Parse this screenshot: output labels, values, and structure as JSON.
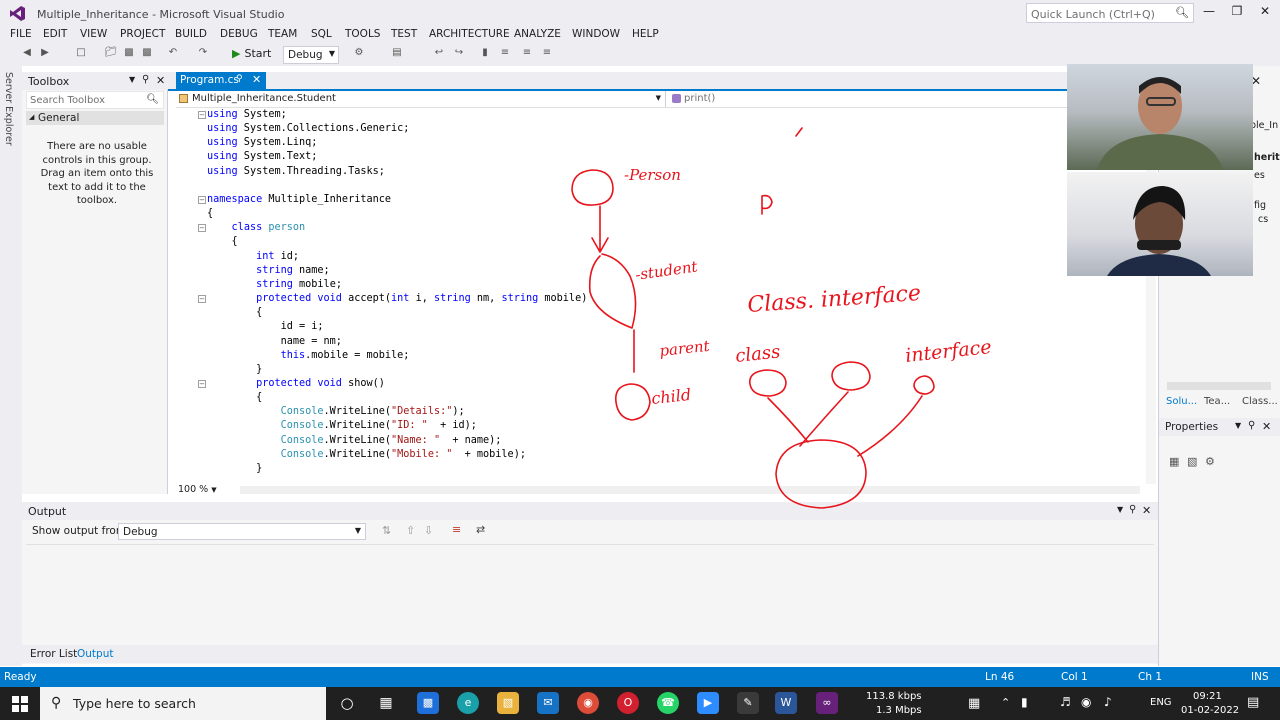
{
  "window": {
    "title": "Multiple_Inheritance - Microsoft Visual Studio",
    "quick_launch_placeholder": "Quick Launch (Ctrl+Q)"
  },
  "menu": [
    "FILE",
    "EDIT",
    "VIEW",
    "PROJECT",
    "BUILD",
    "DEBUG",
    "TEAM",
    "SQL",
    "TOOLS",
    "TEST",
    "ARCHITECTURE",
    "ANALYZE",
    "WINDOW",
    "HELP"
  ],
  "toolbar": {
    "start_label": "Start",
    "config": "Debug"
  },
  "toolbox": {
    "title": "Toolbox",
    "search_placeholder": "Search Toolbox",
    "group": "General",
    "empty_message": "There are no usable controls in this group. Drag an item onto this text to add it to the toolbox."
  },
  "server_explorer": "Server Explorer",
  "editor": {
    "tab": "Program.cs",
    "nav_type": "Multiple_Inheritance.Student",
    "nav_member": "print()",
    "zoom": "100 %",
    "lines": [
      [
        [
          "kw",
          "using"
        ],
        [
          "",
          "System;"
        ]
      ],
      [
        [
          "kw",
          "using"
        ],
        [
          "",
          "System.Collections.Generic;"
        ]
      ],
      [
        [
          "kw",
          "using"
        ],
        [
          "",
          "System.Linq;"
        ]
      ],
      [
        [
          "kw",
          "using"
        ],
        [
          "",
          "System.Text;"
        ]
      ],
      [
        [
          "kw",
          "using"
        ],
        [
          "",
          "System.Threading.Tasks;"
        ]
      ],
      [],
      [
        [
          "kw",
          "namespace"
        ],
        [
          "",
          "Multiple_Inheritance"
        ]
      ],
      [
        [
          "",
          "{"
        ]
      ],
      [
        [
          "",
          "    "
        ],
        [
          "kw",
          "class"
        ],
        [
          "ty",
          "person"
        ]
      ],
      [
        [
          "",
          "    {"
        ]
      ],
      [
        [
          "",
          "        "
        ],
        [
          "kw",
          "int"
        ],
        [
          "",
          "id;"
        ]
      ],
      [
        [
          "",
          "        "
        ],
        [
          "kw",
          "string"
        ],
        [
          "",
          "name;"
        ]
      ],
      [
        [
          "",
          "        "
        ],
        [
          "kw",
          "string"
        ],
        [
          "",
          "mobile;"
        ]
      ],
      [
        [
          "",
          "        "
        ],
        [
          "kw",
          "protected void"
        ],
        [
          "",
          "accept("
        ],
        [
          "kw",
          "int"
        ],
        [
          "",
          "i,"
        ],
        [
          "kw",
          "string"
        ],
        [
          "",
          "nm,"
        ],
        [
          "kw",
          "string"
        ],
        [
          "",
          "mobile)"
        ]
      ],
      [
        [
          "",
          "        {"
        ]
      ],
      [
        [
          "",
          "            id = i;"
        ]
      ],
      [
        [
          "",
          "            name = nm;"
        ]
      ],
      [
        [
          "",
          "            "
        ],
        [
          "kw",
          "this"
        ],
        [
          "",
          ".mobile = mobile;"
        ]
      ],
      [
        [
          "",
          "        }"
        ]
      ],
      [
        [
          "",
          "        "
        ],
        [
          "kw",
          "protected void"
        ],
        [
          "",
          "show()"
        ]
      ],
      [
        [
          "",
          "        {"
        ]
      ],
      [
        [
          "",
          "            "
        ],
        [
          "ty",
          "Console"
        ],
        [
          "",
          ".WriteLine("
        ],
        [
          "st",
          "\"Details:\""
        ],
        [
          "",
          ");"
        ]
      ],
      [
        [
          "",
          "            "
        ],
        [
          "ty",
          "Console"
        ],
        [
          "",
          ".WriteLine("
        ],
        [
          "st",
          "\"ID: \""
        ],
        [
          "",
          " + id);"
        ]
      ],
      [
        [
          "",
          "            "
        ],
        [
          "ty",
          "Console"
        ],
        [
          "",
          ".WriteLine("
        ],
        [
          "st",
          "\"Name: \""
        ],
        [
          "",
          " + name);"
        ]
      ],
      [
        [
          "",
          "            "
        ],
        [
          "ty",
          "Console"
        ],
        [
          "",
          ".WriteLine("
        ],
        [
          "st",
          "\"Mobile: \""
        ],
        [
          "",
          " + mobile);"
        ]
      ],
      [
        [
          "",
          "        }"
        ]
      ]
    ]
  },
  "output": {
    "title": "Output",
    "show_from_label": "Show output from:",
    "source": "Debug"
  },
  "bottom_tabs": {
    "error_list": "Error List",
    "output": "Output"
  },
  "right_panel": {
    "tabs": [
      "Solu...",
      "Tea...",
      "Class..."
    ],
    "properties": "Properties",
    "partial_labels": [
      "ple_In",
      "herit",
      "es",
      "fig",
      "cs"
    ]
  },
  "statusbar": {
    "state": "Ready",
    "ln": "Ln 46",
    "col": "Col 1",
    "ch": "Ch 1",
    "mode": "INS"
  },
  "taskbar": {
    "search_placeholder": "Type here to search",
    "net_down": "113.8 kbps",
    "net_up": "1.3 Mbps",
    "lang": "ENG",
    "time": "09:21",
    "date": "01-02-2022"
  },
  "annotations": {
    "person": "-Person",
    "p": "P",
    "student": "-student",
    "class_interface": "Class. interface",
    "class": "class",
    "parent": "parent",
    "interface": "interface",
    "child": "child"
  },
  "colors": {
    "accent": "#007acc",
    "annotation": "#e8141c",
    "keyword": "#0000ff",
    "type": "#2b91af",
    "string": "#a31515"
  }
}
